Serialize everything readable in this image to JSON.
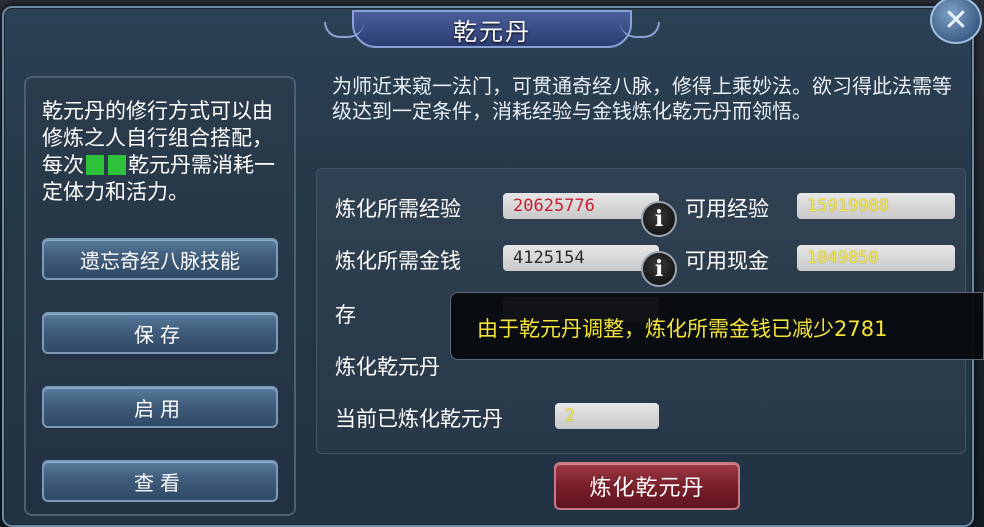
{
  "window": {
    "title": "乾元丹"
  },
  "left_panel": {
    "description_before": "乾元丹的修行方式可以由修炼之人自行组合搭配，每次",
    "description_after": "乾元丹需消耗一定体力和活力。",
    "buttons": {
      "forget_skills": "遗忘奇经八脉技能",
      "save": "保存",
      "enable": "启用",
      "view": "查看"
    }
  },
  "intro": "为师近来窥一法门，可贯通奇经八脉，修得上乘妙法。欲习得此法需等级达到一定条件，消耗经验与金钱炼化乾元丹而领悟。",
  "stats": {
    "required_exp_label": "炼化所需经验",
    "required_exp": "20625776",
    "available_exp_label": "可用经验",
    "available_exp": "15919988",
    "required_money_label": "炼化所需金钱",
    "required_money": "4125154",
    "available_cash_label": "可用现金",
    "available_cash": "1049850",
    "deposit_label": "存",
    "refine_partial_label": "炼化乾元丹",
    "current_refined_label": "当前已炼化乾元丹",
    "current_refined": "2"
  },
  "tooltip": "由于乾元丹调整，炼化所需金钱已减少2781",
  "actions": {
    "refine": "炼化乾元丹"
  },
  "icons": {
    "info": "i",
    "close": "✕"
  },
  "colors": {
    "accent_red": "#7a1f2a",
    "value_yellow": "#f1e64a",
    "value_red": "#c81d2e",
    "tooltip_text": "#f4e43a"
  }
}
